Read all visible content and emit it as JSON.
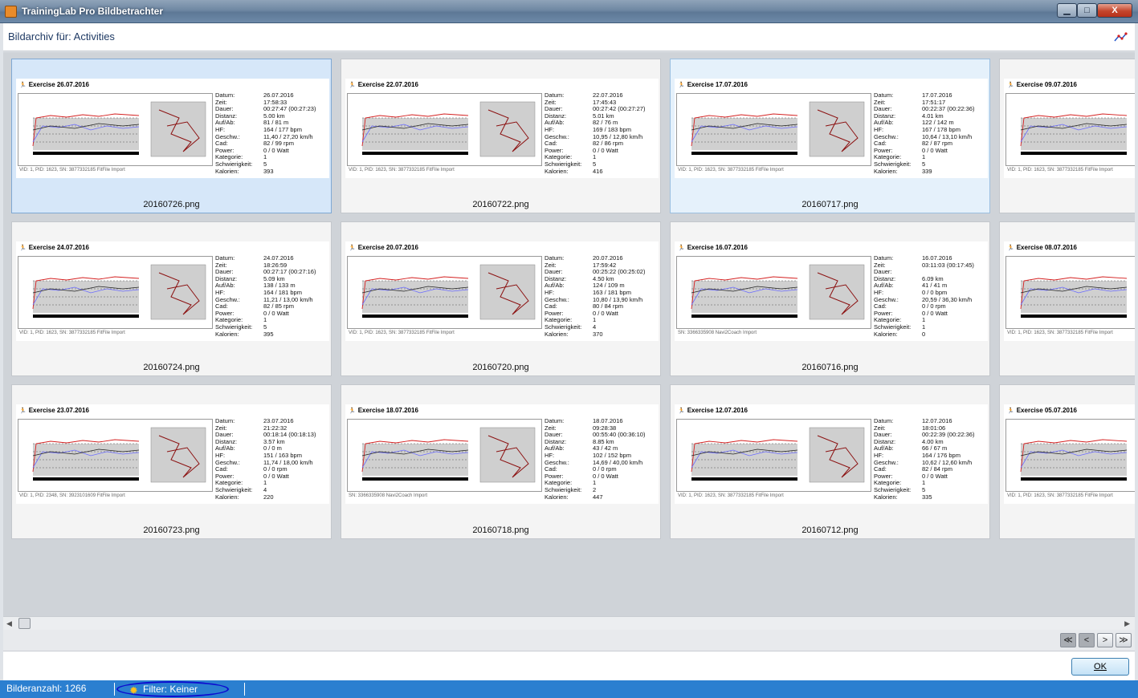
{
  "window": {
    "title": "TrainingLab Pro Bildbetrachter",
    "minimize": "▁",
    "maximize": "□",
    "close": "X"
  },
  "header": {
    "title": "Bildarchiv für: Activities"
  },
  "labels": {
    "kcal": "Kalorien:",
    "datum": "Datum:",
    "zeit": "Zeit:",
    "dauer": "Dauer:",
    "distanz": "Distanz:",
    "aufab": "Auf/Ab:",
    "hf": "HF:",
    "geschw": "Geschw.:",
    "cad": "Cad:",
    "power": "Power:",
    "kategorie": "Kategorie:",
    "schwierigkeit": "Schwierigkeit:"
  },
  "cards": [
    {
      "file": "20160726.png",
      "title": "Exercise 26.07.2016",
      "footer": "VID: 1, PID: 1623, SN: 3877332185 FitFile Import",
      "datum": "26.07.2016",
      "zeit": "17:58:33",
      "dauer": "00:27:47 (00:27:23)",
      "distanz": "5.00 km",
      "aufab": "81 / 81 m",
      "hf": "164 / 177 bpm",
      "geschw": "11,40 / 27,20 km/h",
      "cad": "82 / 99 rpm",
      "power": "0 / 0 Watt",
      "kategorie": "1",
      "schwierigkeit": "5",
      "kalorien": "393"
    },
    {
      "file": "20160722.png",
      "title": "Exercise 22.07.2016",
      "footer": "VID: 1, PID: 1623, SN: 3877332185 FitFile Import",
      "datum": "22.07.2016",
      "zeit": "17:45:43",
      "dauer": "00:27:42 (00:27:27)",
      "distanz": "5.01 km",
      "aufab": "82 / 76 m",
      "hf": "169 / 183 bpm",
      "geschw": "10,95 / 12,80 km/h",
      "cad": "82 / 86 rpm",
      "power": "0 / 0 Watt",
      "kategorie": "1",
      "schwierigkeit": "5",
      "kalorien": "416"
    },
    {
      "file": "20160717.png",
      "title": "Exercise 17.07.2016",
      "footer": "VID: 1, PID: 1623, SN: 3877332185 FitFile Import",
      "datum": "17.07.2016",
      "zeit": "17:51:17",
      "dauer": "00:22:37 (00:22:36)",
      "distanz": "4.01 km",
      "aufab": "122 / 142 m",
      "hf": "167 / 178 bpm",
      "geschw": "10,64 / 13,10 km/h",
      "cad": "82 / 87 rpm",
      "power": "0 / 0 Watt",
      "kategorie": "1",
      "schwierigkeit": "5",
      "kalorien": "339"
    },
    {
      "file": "",
      "title": "Exercise 09.07.2016",
      "footer": "VID: 1, PID: 1623, SN: 3877332185 FitFile Import",
      "datum": "",
      "zeit": "",
      "dauer": "",
      "distanz": "",
      "aufab": "",
      "hf": "",
      "geschw": "",
      "cad": "",
      "power": "",
      "kategorie": "",
      "schwierigkeit": "",
      "kalorien": ""
    },
    {
      "file": "20160724.png",
      "title": "Exercise 24.07.2016",
      "footer": "VID: 1, PID: 1623, SN: 3877332185 FitFile Import",
      "datum": "24.07.2016",
      "zeit": "18:26:59",
      "dauer": "00:27:17 (00:27:16)",
      "distanz": "5.09 km",
      "aufab": "138 / 133 m",
      "hf": "164 / 181 bpm",
      "geschw": "11,21 / 13,00 km/h",
      "cad": "82 / 85 rpm",
      "power": "0 / 0 Watt",
      "kategorie": "1",
      "schwierigkeit": "5",
      "kalorien": "395"
    },
    {
      "file": "20160720.png",
      "title": "Exercise 20.07.2016",
      "footer": "VID: 1, PID: 1623, SN: 3877332185 FitFile Import",
      "datum": "20.07.2016",
      "zeit": "17:59:42",
      "dauer": "00:25:22 (00:25:02)",
      "distanz": "4.50 km",
      "aufab": "124 / 109 m",
      "hf": "163 / 181 bpm",
      "geschw": "10,80 / 13,90 km/h",
      "cad": "80 / 84 rpm",
      "power": "0 / 0 Watt",
      "kategorie": "1",
      "schwierigkeit": "4",
      "kalorien": "370"
    },
    {
      "file": "20160716.png",
      "title": "Exercise 16.07.2016",
      "footer": "SN: 3366335908 Navi2Coach Import",
      "datum": "16.07.2016",
      "zeit": "03:11:03 (00:17:45)",
      "dauer": "",
      "distanz": "6.09 km",
      "aufab": "41 / 41 m",
      "hf": "0 / 0 bpm",
      "geschw": "20,59 / 36,30 km/h",
      "cad": "0 / 0 rpm",
      "power": "0 / 0 Watt",
      "kategorie": "1",
      "schwierigkeit": "1",
      "kalorien": "0"
    },
    {
      "file": "",
      "title": "Exercise 08.07.2016",
      "footer": "VID: 1, PID: 1623, SN: 3877332185 FitFile Import",
      "datum": "",
      "zeit": "",
      "dauer": "",
      "distanz": "",
      "aufab": "",
      "hf": "",
      "geschw": "",
      "cad": "",
      "power": "",
      "kategorie": "",
      "schwierigkeit": "",
      "kalorien": ""
    },
    {
      "file": "20160723.png",
      "title": "Exercise 23.07.2016",
      "footer": "VID: 1, PID: 2348, SN: 3923101609 FitFile Import",
      "datum": "23.07.2016",
      "zeit": "21:22:32",
      "dauer": "00:18:14 (00:18:13)",
      "distanz": "3.57 km",
      "aufab": "0 / 0 m",
      "hf": "151 / 163 bpm",
      "geschw": "11,74 / 18,00 km/h",
      "cad": "0 / 0 rpm",
      "power": "0 / 0 Watt",
      "kategorie": "1",
      "schwierigkeit": "4",
      "kalorien": "220"
    },
    {
      "file": "20160718.png",
      "title": "Exercise 18.07.2016",
      "footer": "SN: 3366335908 Navi2Coach Import",
      "datum": "18.07.2016",
      "zeit": "09:28:38",
      "dauer": "00:55:40 (00:36:10)",
      "distanz": "8.85 km",
      "aufab": "43 / 42 m",
      "hf": "102 / 152 bpm",
      "geschw": "14,69 / 40,00 km/h",
      "cad": "0 / 0 rpm",
      "power": "0 / 0 Watt",
      "kategorie": "1",
      "schwierigkeit": "2",
      "kalorien": "447"
    },
    {
      "file": "20160712.png",
      "title": "Exercise 12.07.2016",
      "footer": "VID: 1, PID: 1623, SN: 3877332185 FitFile Import",
      "datum": "12.07.2016",
      "zeit": "18:01:06",
      "dauer": "00:22:39 (00:22:36)",
      "distanz": "4.00 km",
      "aufab": "66 / 67 m",
      "hf": "164 / 176 bpm",
      "geschw": "10,62 / 12,60 km/h",
      "cad": "82 / 84 rpm",
      "power": "0 / 0 Watt",
      "kategorie": "1",
      "schwierigkeit": "5",
      "kalorien": "335"
    },
    {
      "file": "",
      "title": "Exercise 05.07.2016",
      "footer": "VID: 1, PID: 1623, SN: 3877332185 FitFile Import",
      "datum": "",
      "zeit": "",
      "dauer": "",
      "distanz": "",
      "aufab": "",
      "hf": "",
      "geschw": "",
      "cad": "",
      "power": "",
      "kategorie": "",
      "schwierigkeit": "",
      "kalorien": ""
    }
  ],
  "nav": {
    "first": "≪",
    "prev": "<",
    "next": ">",
    "last": "≫"
  },
  "footer": {
    "ok": "OK"
  },
  "status": {
    "count": "Bilderanzahl: 1266",
    "filter": "Filter: Keiner",
    "filter_icon": "gear-icon"
  },
  "colors": {
    "status_bar": "#2b7fd0",
    "hr_line": "#d42020",
    "speed_line": "#6a6aff",
    "selection": "#d6e7f9"
  }
}
